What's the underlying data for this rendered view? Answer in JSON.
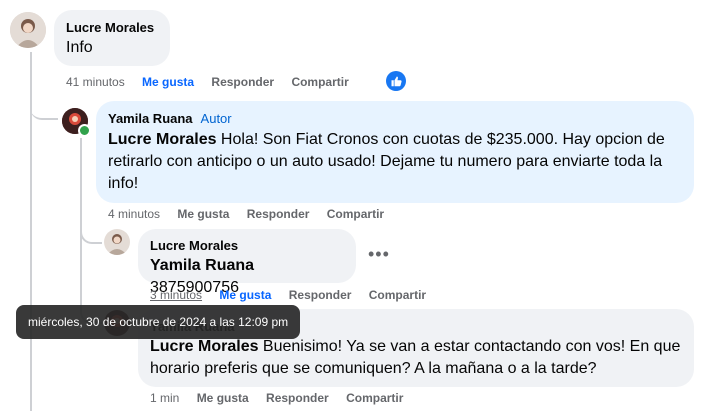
{
  "comments": [
    {
      "author": "Lucre Morales",
      "text": "Info",
      "time": "41 minutos",
      "like": "Me gusta",
      "reply": "Responder",
      "share": "Compartir",
      "reactions": "like"
    },
    {
      "author": "Yamila Ruana",
      "badge": "Autor",
      "mention": "Lucre Morales",
      "text": " Hola! Son Fiat Cronos con cuotas de $235.000. Hay opcion de retirarlo con anticipo o un auto usado! Dejame tu numero para enviarte toda la info!",
      "time": "4 minutos",
      "like": "Me gusta",
      "reply": "Responder",
      "share": "Compartir"
    },
    {
      "author": "Lucre Morales",
      "mention": "Yamila Ruana",
      "text": " 3875900756",
      "time": "3 minutos",
      "like": "Me gusta",
      "reply": "Responder",
      "share": "Compartir"
    },
    {
      "author": "Yamila Ruana",
      "mention": "Lucre Morales",
      "text": " Buenisimo! Ya se van a estar contactando con vos! En que horario preferis que se comuniquen? A la mañana o a la tarde?",
      "time": "1 min",
      "like": "Me gusta",
      "reply": "Responder",
      "share": "Compartir"
    }
  ],
  "tooltip": "miércoles, 30 de octubre de 2024 a las 12:09 pm",
  "icons": {
    "more": "more-options-icon",
    "like": "thumbs-up-icon"
  },
  "colors": {
    "accent": "#0866ff",
    "author_bubble": "#e7f3ff",
    "bubble": "#f0f2f5"
  }
}
